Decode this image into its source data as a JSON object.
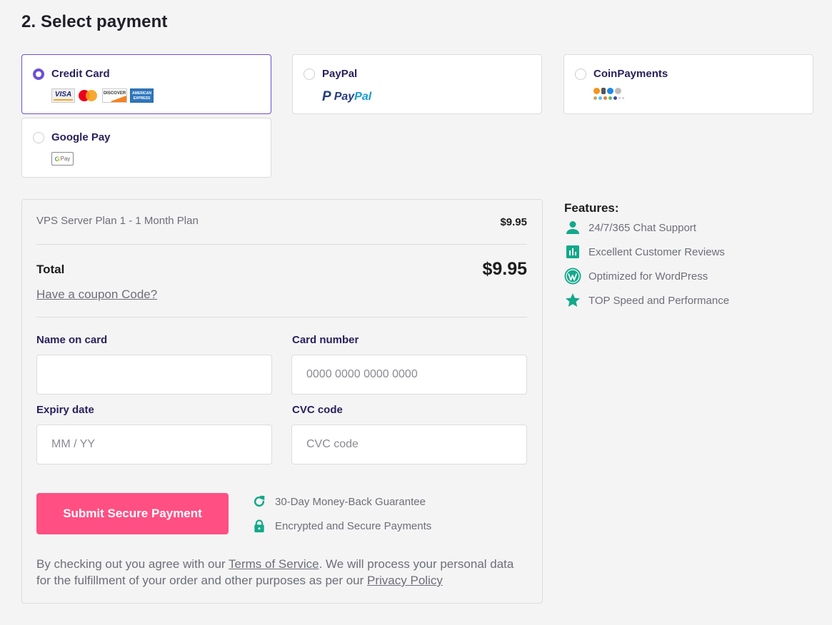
{
  "page": {
    "title": "2. Select payment"
  },
  "payment_methods": [
    {
      "id": "credit-card",
      "label": "Credit Card",
      "selected": true,
      "logos": [
        "VISA",
        "mastercard",
        "DISCOVER",
        "AMERICAN EXPRESS"
      ]
    },
    {
      "id": "paypal",
      "label": "PayPal",
      "selected": false,
      "logos": [
        "PayPal"
      ]
    },
    {
      "id": "coinpayments",
      "label": "CoinPayments",
      "selected": false,
      "logos": [
        "bitcoin",
        "ethereum",
        "ripple",
        "litecoin",
        "more coins"
      ]
    },
    {
      "id": "google-pay",
      "label": "Google Pay",
      "selected": false,
      "logos": [
        "G Pay"
      ]
    }
  ],
  "logos": {
    "visa": "VISA",
    "discover": "DISCOVER",
    "amex_line1": "AMERICAN",
    "amex_line2": "EXPRESS",
    "paypal_a": "Pay",
    "paypal_b": "Pal",
    "paypal_p": "P",
    "gpay_g": "G",
    "gpay_text": "Pay"
  },
  "order": {
    "plan_name": "VPS Server Plan 1 - 1 Month Plan",
    "plan_price": "$9.95",
    "total_label": "Total",
    "total_value": "$9.95",
    "coupon_link": "Have a coupon Code?"
  },
  "form": {
    "name_label": "Name on card",
    "name_value": "",
    "name_placeholder": "",
    "card_label": "Card number",
    "card_value": "",
    "card_placeholder": "0000 0000 0000 0000",
    "expiry_label": "Expiry date",
    "expiry_value": "",
    "expiry_placeholder": "MM / YY",
    "cvc_label": "CVC code",
    "cvc_value": "",
    "cvc_placeholder": "CVC code"
  },
  "submit": {
    "label": "Submit Secure Payment"
  },
  "assurances": [
    {
      "icon": "refresh-icon",
      "text": "30-Day Money-Back Guarantee"
    },
    {
      "icon": "lock-icon",
      "text": "Encrypted and Secure Payments"
    }
  ],
  "legal": {
    "part1": "By checking out you agree with our ",
    "terms_link": "Terms of Service",
    "part2": ". We will process your personal data for the fulfillment of your order and other purposes as per our ",
    "privacy_link": "Privacy Policy"
  },
  "features": {
    "title": "Features:",
    "items": [
      {
        "icon": "user-icon",
        "text": "24/7/365 Chat Support"
      },
      {
        "icon": "chart-icon",
        "text": "Excellent Customer Reviews"
      },
      {
        "icon": "wordpress-icon",
        "text": "Optimized for WordPress"
      },
      {
        "icon": "star-icon",
        "text": "TOP Speed and Performance"
      }
    ]
  },
  "colors": {
    "accent_purple": "#6c4fd8",
    "label_navy": "#2a1f5a",
    "submit_pink": "#ff4f83",
    "icon_teal": "#13a88a",
    "muted_text": "#6e6e7a"
  }
}
